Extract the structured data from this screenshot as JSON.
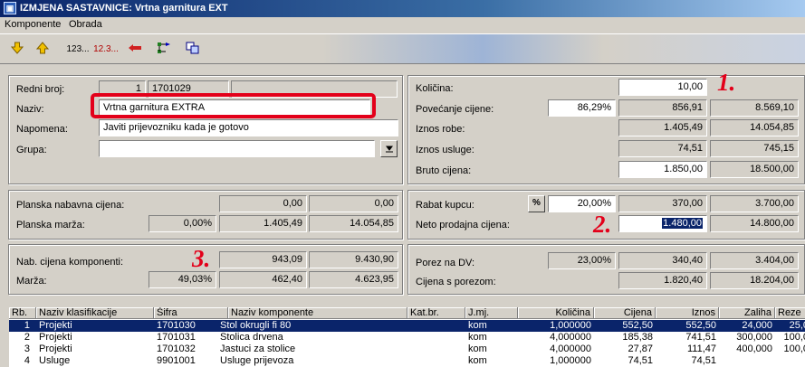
{
  "window": {
    "title": "IZMJENA SASTAVNICE: Vrtna garnitura EXT"
  },
  "menu": [
    "Komponente",
    "Obrada"
  ],
  "toolbar": {
    "seq1": "123...",
    "seq2": "12.3..."
  },
  "form": {
    "redni_broj_label": "Redni broj:",
    "redni_broj_a": "1",
    "redni_broj_b": "1701029",
    "redni_broj_c": "",
    "naziv_label": "Naziv:",
    "naziv_value": "Vrtna garnitura EXTRA",
    "napomena_label": "Napomena:",
    "napomena_value": "Javiti prijevozniku kada je gotovo",
    "grupa_label": "Grupa:",
    "grupa_value": ""
  },
  "plan": {
    "nabavna_label": "Planska nabavna cijena:",
    "nabavna_1": "0,00",
    "nabavna_2": "0,00",
    "marza_label": "Planska marža:",
    "marza_pct": "0,00%",
    "marza_1": "1.405,49",
    "marza_2": "14.054,85"
  },
  "komp": {
    "nab_label": "Nab. cijena komponenti:",
    "nab_1": "943,09",
    "nab_2": "9.430,90",
    "marza_label": "Marža:",
    "marza_pct": "49,03%",
    "marza_1": "462,40",
    "marza_2": "4.623,95"
  },
  "right": {
    "kolicina_label": "Količina:",
    "kolicina": "10,00",
    "povecanje_label": "Povećanje cijene:",
    "povecanje_pct": "86,29%",
    "povecanje_1": "856,91",
    "povecanje_2": "8.569,10",
    "iznos_robe_label": "Iznos robe:",
    "iznos_robe_1": "1.405,49",
    "iznos_robe_2": "14.054,85",
    "iznos_usluge_label": "Iznos usluge:",
    "iznos_usluge_1": "74,51",
    "iznos_usluge_2": "745,15",
    "bruto_label": "Bruto cijena:",
    "bruto_1": "1.850,00",
    "bruto_2": "18.500,00",
    "rabat_label": "Rabat kupcu:",
    "rabat_btn": "%",
    "rabat_pct": "20,00%",
    "rabat_1": "370,00",
    "rabat_2": "3.700,00",
    "neto_label": "Neto prodajna cijena:",
    "neto_1": "1.480,00",
    "neto_2": "14.800,00",
    "porez_label": "Porez na DV:",
    "porez_pct": "23,00%",
    "porez_1": "340,40",
    "porez_2": "3.404,00",
    "sporezom_label": "Cijena s porezom:",
    "sporezom_1": "1.820,40",
    "sporezom_2": "18.204,00"
  },
  "annotations": {
    "a1": "1.",
    "a2": "2.",
    "a3": "3."
  },
  "colors": {
    "annotation": "#e3001a",
    "selection": "#0a246a"
  },
  "grid": {
    "headers": [
      "Rb.",
      "Naziv klasifikacije",
      "Šifra",
      "Naziv komponente",
      "Kat.br.",
      "J.mj.",
      "Količina",
      "Cijena",
      "Iznos",
      "Zaliha",
      "Reze"
    ],
    "rows": [
      [
        "1",
        "Projekti",
        "1701030",
        "Stol okrugli fi 80",
        "",
        "kom",
        "1,000000",
        "552,50",
        "552,50",
        "24,000",
        "25,0"
      ],
      [
        "2",
        "Projekti",
        "1701031",
        "Stolica drvena",
        "",
        "kom",
        "4,000000",
        "185,38",
        "741,51",
        "300,000",
        "100,0"
      ],
      [
        "3",
        "Projekti",
        "1701032",
        "Jastuci za stolice",
        "",
        "kom",
        "4,000000",
        "27,87",
        "111,47",
        "400,000",
        "100,0"
      ],
      [
        "4",
        "Usluge",
        "9901001",
        "Usluge prijevoza",
        "",
        "kom",
        "1,000000",
        "74,51",
        "74,51",
        "",
        ""
      ]
    ]
  }
}
